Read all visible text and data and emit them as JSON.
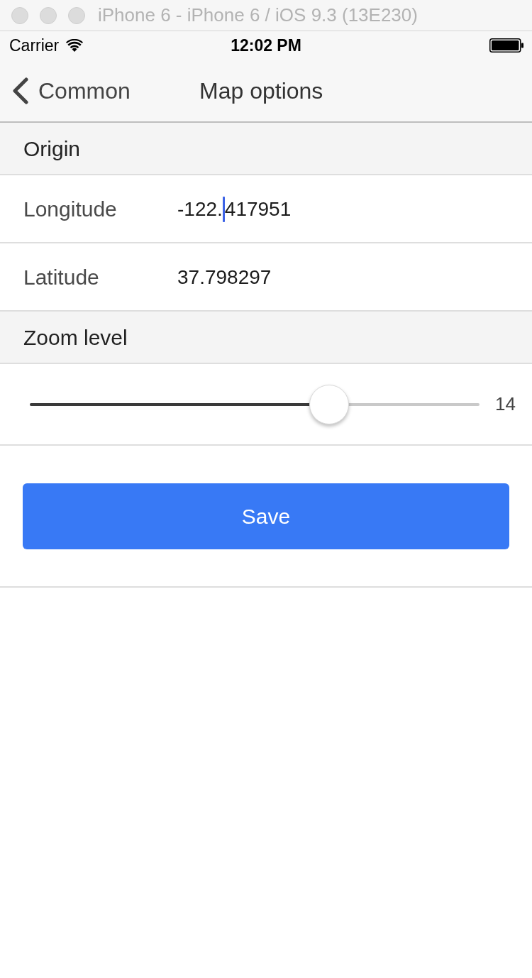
{
  "window": {
    "title": "iPhone 6 - iPhone 6 / iOS 9.3 (13E230)",
    "active": false
  },
  "status_bar": {
    "carrier": "Carrier",
    "time": "12:02 PM"
  },
  "nav_bar": {
    "back_label": "Common",
    "title": "Map options"
  },
  "sections": [
    {
      "kind": "fields",
      "header": "Origin",
      "rows": [
        {
          "label": "Longitude",
          "value": "-122.417951",
          "focused": true
        },
        {
          "label": "Latitude",
          "value": "37.798297",
          "focused": false
        }
      ]
    },
    {
      "kind": "slider",
      "header": "Zoom level",
      "level": 0.665,
      "reading": "14"
    }
  ],
  "save_button": {
    "label": "Save"
  }
}
